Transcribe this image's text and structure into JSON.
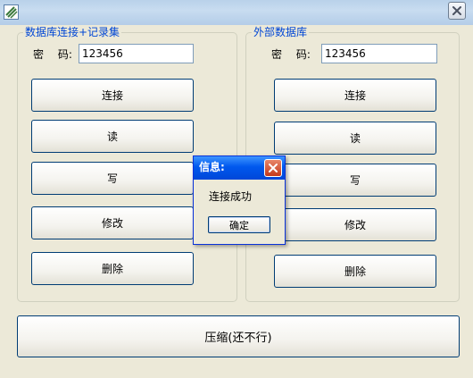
{
  "window": {
    "icon": "app-icon",
    "close_icon": "close-icon"
  },
  "left_panel": {
    "title": "数据库连接+记录集",
    "password_label": "密　 码:",
    "password_value": "123456",
    "buttons": [
      "连接",
      "读",
      "写",
      "修改",
      "删除"
    ]
  },
  "right_panel": {
    "title": "外部数据库",
    "password_label": "密　 码:",
    "password_value": "123456",
    "buttons": [
      "连接",
      "读",
      "写",
      "修改",
      "删除"
    ]
  },
  "bottom_button": "压缩(还不行)",
  "dialog": {
    "title": "信息:",
    "message": "连接成功",
    "ok_label": "确定",
    "close_icon": "close-icon"
  },
  "colors": {
    "window_bg": "#ece9d8",
    "group_title": "#0046d5",
    "dialog_titlebar": "#0058ee",
    "dialog_close": "#c4391b"
  }
}
